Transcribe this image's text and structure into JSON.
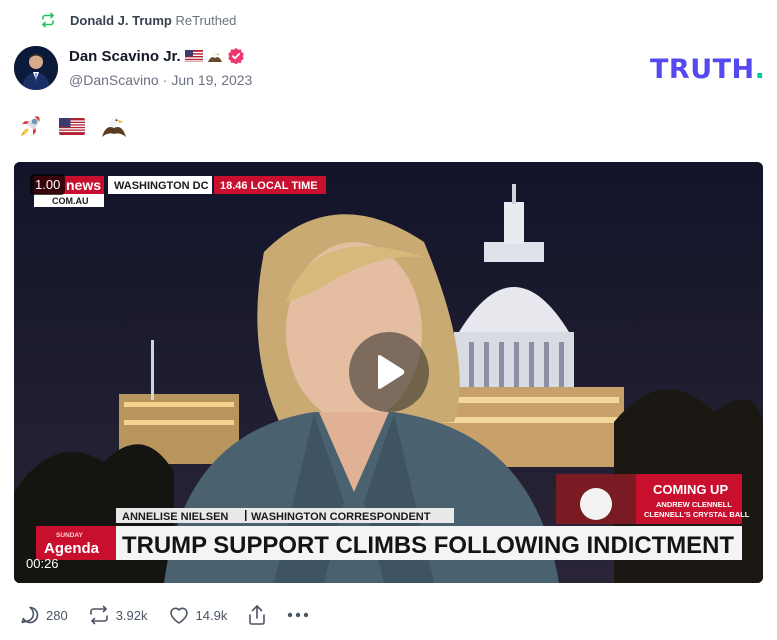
{
  "retruth": {
    "user": "Donald J. Trump",
    "label": "ReTruthed"
  },
  "author": {
    "display_name": "Dan Scavino Jr.",
    "handle": "@DanScavino",
    "separator": "·",
    "date": "Jun 19, 2023"
  },
  "brand": {
    "logo": "TRUTH",
    "logo_dot": "."
  },
  "post": {
    "emojis": [
      "rocket",
      "us-flag",
      "eagle"
    ]
  },
  "video": {
    "playback_speed": "1.00",
    "time": "00:26",
    "news_brand": "news",
    "news_domain": "COM.AU",
    "location": "WASHINGTON DC",
    "local_time": "18.46 LOCAL TIME",
    "reporter_name": "ANNELISE NIELSEN",
    "reporter_role": "WASHINGTON CORRESPONDENT",
    "headline": "TRUMP SUPPORT CLIMBS FOLLOWING INDICTMENT",
    "show_small": "SUNDAY",
    "show_name": "Agenda",
    "coming_up": "COMING UP",
    "coming_up_name": "ANDREW CLENNELL",
    "coming_up_segment": "CLENNELL'S CRYSTAL BALL"
  },
  "actions": {
    "replies": "280",
    "retruths": "3.92k",
    "likes": "14.9k"
  },
  "colors": {
    "brand_purple": "#5448ee",
    "brand_green": "#00c8a0",
    "retruth_green": "#22c55e",
    "verified_pink": "#f0366e",
    "news_red": "#c8102e"
  }
}
